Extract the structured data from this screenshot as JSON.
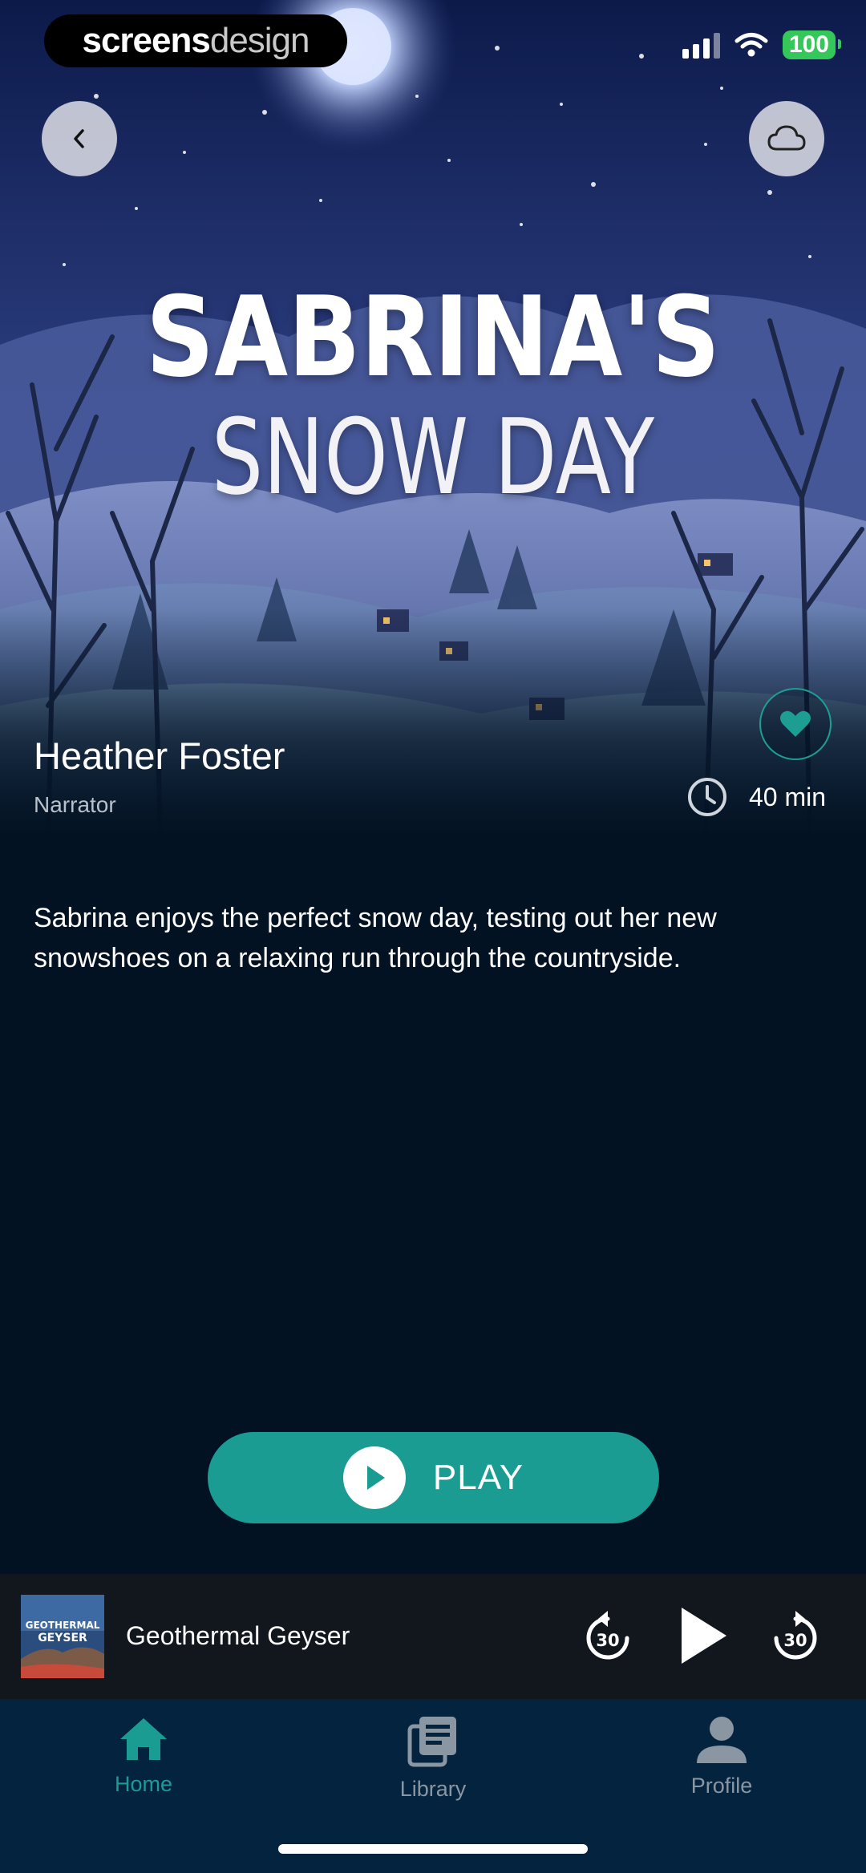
{
  "brand_badge": {
    "part1": "screens",
    "part2": "design"
  },
  "status_bar": {
    "battery": "100"
  },
  "story": {
    "title_line1": "SABRINA'S",
    "title_line2": "SNOW DAY",
    "narrator_name": "Heather Foster",
    "narrator_role": "Narrator",
    "duration": "40 min",
    "description": "Sabrina enjoys the perfect snow day, testing out her new snowshoes on a relaxing run through the countryside.",
    "play_label": "PLAY"
  },
  "mini_player": {
    "title": "Geothermal Geyser",
    "thumb_text_line1": "GEOTHERMAL",
    "thumb_text_line2": "GEYSER",
    "rewind_seconds": "30",
    "forward_seconds": "30"
  },
  "tabs": [
    {
      "label": "Home",
      "active": true
    },
    {
      "label": "Library",
      "active": false
    },
    {
      "label": "Profile",
      "active": false
    }
  ],
  "colors": {
    "accent": "#1a9c93",
    "background": "#021222",
    "tabbar": "#03233e",
    "mini_player": "#12161d",
    "inactive_tab": "#8a96a2"
  },
  "icons": {
    "back": "chevron-left-icon",
    "cloud": "cloud-icon",
    "favorite": "heart-icon",
    "duration": "clock-icon",
    "play": "play-icon",
    "rewind": "rewind-30-icon",
    "forward": "forward-30-icon",
    "home": "home-icon",
    "library": "library-icon",
    "profile": "profile-icon"
  }
}
